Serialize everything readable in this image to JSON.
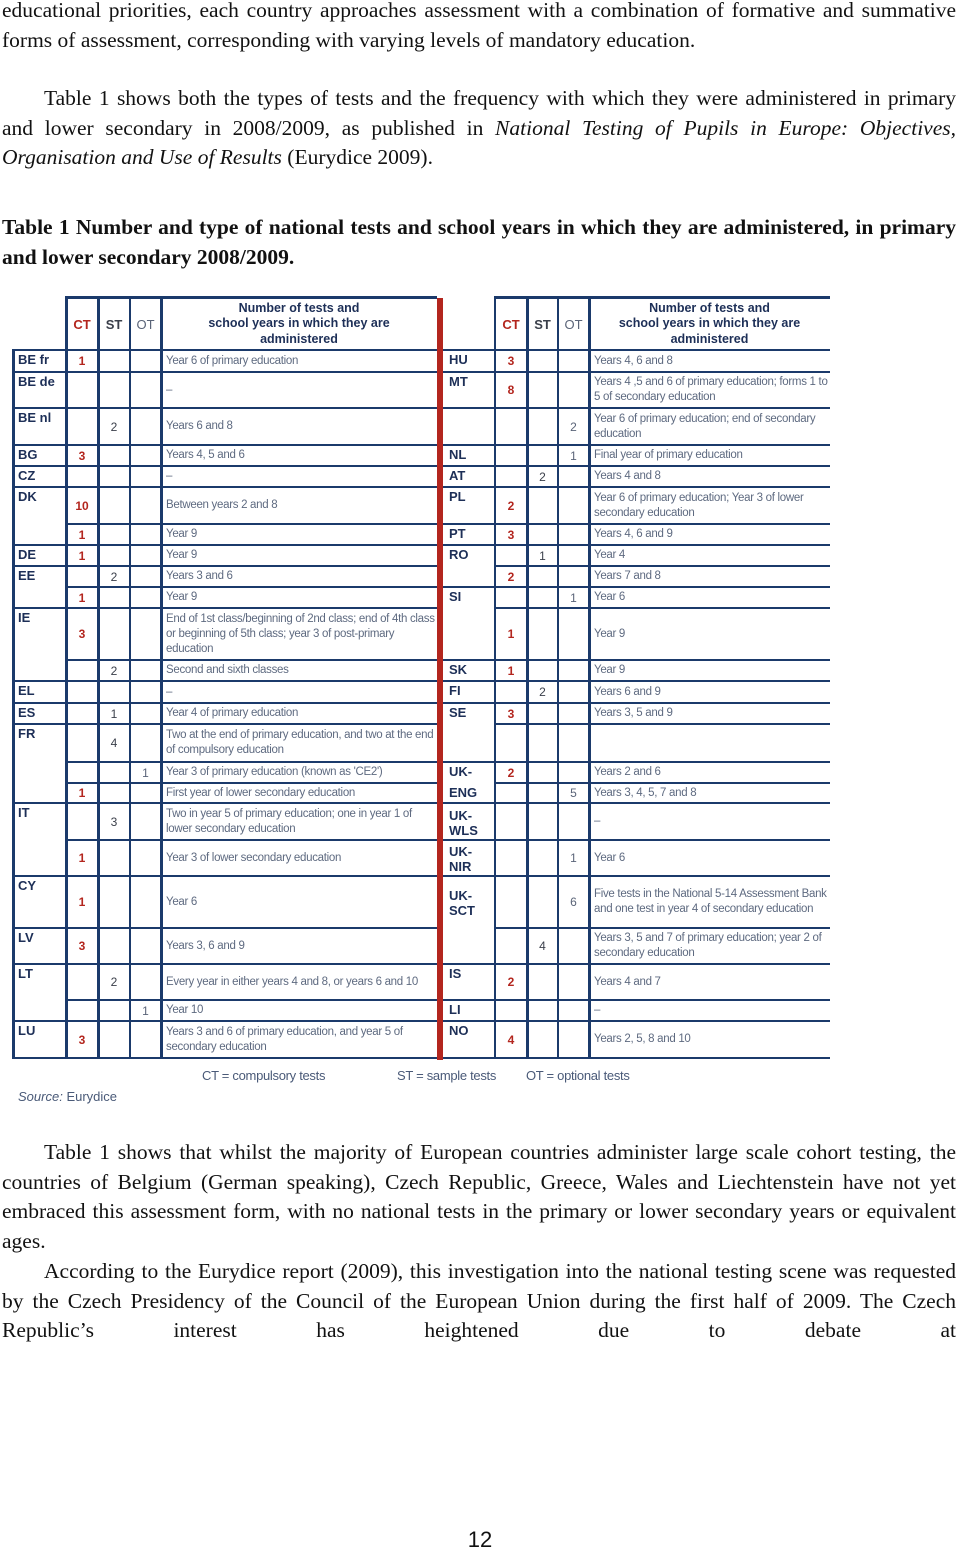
{
  "intro": {
    "p1_lines": "educational priorities, each country approaches assessment with a combination of formative and summative forms of assessment, corresponding with varying levels of mandatory education.",
    "p2_before": "Table 1 shows both the types of tests and the frequency with which they were administered in primary and lower secondary in 2008/2009, as published in ",
    "p2_italic": "National Testing of Pupils in Europe: Objectives, Organisation and Use of Results",
    "p2_after": " (Eurydice 2009)."
  },
  "caption": "Table 1 Number and type of national tests and school years in which they are administered, in primary and lower secondary 2008/2009.",
  "table": {
    "headers": {
      "ct": "CT",
      "st": "ST",
      "ot": "OT",
      "desc_line1": "Number of tests and",
      "desc_line2": "school years in which they are",
      "desc_line3": "administered"
    },
    "left_rows": [
      {
        "code": "BE fr",
        "ct": "1",
        "st": "",
        "ot": "",
        "desc": "Year 6 of primary education"
      },
      {
        "code": "BE de",
        "ct": "",
        "st": "",
        "ot": "",
        "desc": "–"
      },
      {
        "code": "BE nl",
        "ct": "",
        "st": "2",
        "ot": "",
        "desc": "Years 6 and 8"
      },
      {
        "code": "BG",
        "ct": "3",
        "st": "",
        "ot": "",
        "desc": "Years 4, 5 and 6"
      },
      {
        "code": "CZ",
        "ct": "",
        "st": "",
        "ot": "",
        "desc": "–"
      },
      {
        "code": "DK",
        "ct": "10",
        "st": "",
        "ot": "",
        "desc": "Between years 2 and 8"
      },
      {
        "code": "",
        "ct": "1",
        "st": "",
        "ot": "",
        "desc": "Year 9"
      },
      {
        "code": "DE",
        "ct": "1",
        "st": "",
        "ot": "",
        "desc": "Year 9"
      },
      {
        "code": "EE",
        "ct": "",
        "st": "2",
        "ot": "",
        "desc": "Years 3 and 6"
      },
      {
        "code": "",
        "ct": "1",
        "st": "",
        "ot": "",
        "desc": "Year 9"
      },
      {
        "code": "IE",
        "ct": "3",
        "st": "",
        "ot": "",
        "desc": "End of 1st class/beginning of 2nd class; end of 4th class or beginning of 5th class; year 3 of post-primary education"
      },
      {
        "code": "",
        "ct": "",
        "st": "2",
        "ot": "",
        "desc": "Second and sixth classes"
      },
      {
        "code": "EL",
        "ct": "",
        "st": "",
        "ot": "",
        "desc": "–"
      },
      {
        "code": "ES",
        "ct": "",
        "st": "1",
        "ot": "",
        "desc": "Year 4 of primary education"
      },
      {
        "code": "FR",
        "ct": "",
        "st": "4",
        "ot": "",
        "desc": "Two at the end of primary education, and two at the end of compulsory education"
      },
      {
        "code": "",
        "ct": "",
        "st": "",
        "ot": "1",
        "desc": "Year 3 of primary education (known as 'CE2')"
      },
      {
        "code": "",
        "ct": "1",
        "st": "",
        "ot": "",
        "desc": "First year of lower secondary education"
      },
      {
        "code": "IT",
        "ct": "",
        "st": "3",
        "ot": "",
        "desc": "Two in year 5 of primary education; one in year 1 of lower secondary education"
      },
      {
        "code": "",
        "ct": "1",
        "st": "",
        "ot": "",
        "desc": "Year 3 of lower secondary education"
      },
      {
        "code": "CY",
        "ct": "1",
        "st": "",
        "ot": "",
        "desc": "Year 6"
      },
      {
        "code": "LV",
        "ct": "3",
        "st": "",
        "ot": "",
        "desc": "Years 3, 6 and 9"
      },
      {
        "code": "LT",
        "ct": "",
        "st": "2",
        "ot": "",
        "desc": "Every year in either years 4 and 8, or years 6 and 10"
      },
      {
        "code": "",
        "ct": "",
        "st": "",
        "ot": "1",
        "desc": "Year 10"
      },
      {
        "code": "LU",
        "ct": "3",
        "st": "",
        "ot": "",
        "desc": "Years 3 and 6 of primary education, and year 5 of secondary education"
      }
    ],
    "right_rows": [
      {
        "code": "HU",
        "ct": "3",
        "st": "",
        "ot": "",
        "desc": "Years 4, 6 and 8"
      },
      {
        "code": "MT",
        "ct": "8",
        "st": "",
        "ot": "",
        "desc": "Years 4 ,5 and 6 of primary education; forms 1 to 5 of secondary education"
      },
      {
        "code": "",
        "ct": "",
        "st": "",
        "ot": "2",
        "desc": "Year 6 of primary education; end of secondary education"
      },
      {
        "code": "NL",
        "ct": "",
        "st": "",
        "ot": "1",
        "desc": "Final year of primary education"
      },
      {
        "code": "AT",
        "ct": "",
        "st": "2",
        "ot": "",
        "desc": "Years 4 and 8"
      },
      {
        "code": "PL",
        "ct": "2",
        "st": "",
        "ot": "",
        "desc": "Year 6 of primary education; Year 3 of lower secondary education"
      },
      {
        "code": "PT",
        "ct": "3",
        "st": "",
        "ot": "",
        "desc": "Years 4, 6 and 9"
      },
      {
        "code": "RO",
        "ct": "",
        "st": "1",
        "ot": "",
        "desc": "Year 4"
      },
      {
        "code": "",
        "ct": "2",
        "st": "",
        "ot": "",
        "desc": "Years 7 and 8"
      },
      {
        "code": "SI",
        "ct": "",
        "st": "",
        "ot": "1",
        "desc": "Year 6"
      },
      {
        "code": "",
        "ct": "1",
        "st": "",
        "ot": "",
        "desc": "Year 9"
      },
      {
        "code": "SK",
        "ct": "1",
        "st": "",
        "ot": "",
        "desc": "Year 9"
      },
      {
        "code": "FI",
        "ct": "",
        "st": "2",
        "ot": "",
        "desc": "Years 6 and 9"
      },
      {
        "code": "SE",
        "ct": "3",
        "st": "",
        "ot": "",
        "desc": "Years 3, 5 and 9"
      },
      {
        "code": "",
        "ct": "",
        "st": "",
        "ot": "",
        "desc": ""
      },
      {
        "code": "UK-",
        "ct": "2",
        "st": "",
        "ot": "",
        "desc": "Years 2 and 6"
      },
      {
        "code": "ENG",
        "ct": "",
        "st": "",
        "ot": "5",
        "desc": "Years 3, 4, 5, 7 and 8"
      },
      {
        "code": "UK-WLS",
        "ct": "",
        "st": "",
        "ot": "",
        "desc": "–"
      },
      {
        "code": "UK-NIR",
        "ct": "",
        "st": "",
        "ot": "1",
        "desc": "Year 6"
      },
      {
        "code": "UK-SCT",
        "ct": "",
        "st": "",
        "ot": "6",
        "desc": "Five tests in the National 5-14 Assessment Bank and one test in year 4 of secondary education"
      },
      {
        "code": "",
        "ct": "",
        "st": "4",
        "ot": "",
        "desc": "Years 3, 5 and 7 of primary education; year 2 of secondary education"
      },
      {
        "code": "IS",
        "ct": "2",
        "st": "",
        "ot": "",
        "desc": "Years 4 and 7"
      },
      {
        "code": "LI",
        "ct": "",
        "st": "",
        "ot": "",
        "desc": "–"
      },
      {
        "code": "NO",
        "ct": "4",
        "st": "",
        "ot": "",
        "desc": "Years 2, 5, 8 and 10"
      }
    ],
    "legend": {
      "ct": "CT = compulsory tests",
      "st": "ST = sample tests",
      "ot": "OT = optional tests"
    },
    "source_label": "Source:",
    "source_value": "Eurydice"
  },
  "body": {
    "p3": "Table 1 shows that whilst the majority of European countries administer large scale cohort testing, the countries of Belgium (German speaking), Czech Republic, Greece, Wales and Liechtenstein have not yet embraced this assessment form, with no national tests in the primary or lower secondary years or equivalent ages.",
    "p4": "According to the Eurydice report (2009), this investigation into the national testing scene was requested by the Czech Presidency of the Council of the European Union during the first half of 2009. The Czech Republic’s interest has heightened due to debate at"
  },
  "page_number": "12"
}
